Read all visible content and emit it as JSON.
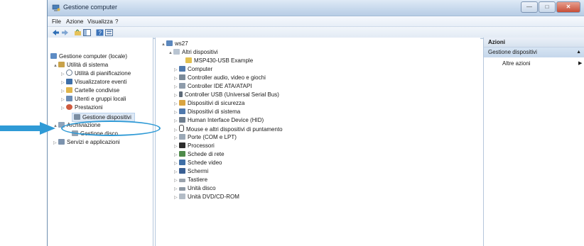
{
  "window": {
    "title": "Gestione computer"
  },
  "menu": [
    "File",
    "Azione",
    "Visualizza",
    "?"
  ],
  "tree": [
    {
      "label": "Gestione computer (locale)",
      "level": 0,
      "expander": ""
    },
    {
      "label": "Utilità di sistema",
      "level": 1,
      "expander": "▲"
    },
    {
      "label": "Utilità di pianificazione",
      "level": 2,
      "expander": "▷"
    },
    {
      "label": "Visualizzatore eventi",
      "level": 2,
      "expander": "▷"
    },
    {
      "label": "Cartelle condivise",
      "level": 2,
      "expander": "▷"
    },
    {
      "label": "Utenti e gruppi locali",
      "level": 2,
      "expander": "▷"
    },
    {
      "label": "Prestazioni",
      "level": 2,
      "expander": "▷"
    },
    {
      "label": "Gestione dispositivi",
      "level": 2,
      "expander": "",
      "selected": true
    },
    {
      "label": "Archiviazione",
      "level": 1,
      "expander": "▲"
    },
    {
      "label": "Gestione disco",
      "level": 2,
      "expander": ""
    },
    {
      "label": "Servizi e applicazioni",
      "level": 1,
      "expander": "▷"
    }
  ],
  "devices": [
    {
      "label": "ws27",
      "level": 0,
      "expander": "▲"
    },
    {
      "label": "Altri dispositivi",
      "level": 1,
      "expander": "▲"
    },
    {
      "label": "MSP430-USB Example",
      "level": 2,
      "expander": ""
    },
    {
      "label": "Computer",
      "level": 1,
      "expander": "▷"
    },
    {
      "label": "Controller audio, video e giochi",
      "level": 1,
      "expander": "▷"
    },
    {
      "label": "Controller IDE ATA/ATAPI",
      "level": 1,
      "expander": "▷"
    },
    {
      "label": "Controller USB (Universal Serial Bus)",
      "level": 1,
      "expander": "▷"
    },
    {
      "label": "Dispositivi di sicurezza",
      "level": 1,
      "expander": "▷"
    },
    {
      "label": "Dispositivi di sistema",
      "level": 1,
      "expander": "▷"
    },
    {
      "label": "Human Interface Device (HID)",
      "level": 1,
      "expander": "▷"
    },
    {
      "label": "Mouse e altri dispositivi di puntamento",
      "level": 1,
      "expander": "▷"
    },
    {
      "label": "Porte (COM e LPT)",
      "level": 1,
      "expander": "▷"
    },
    {
      "label": "Processori",
      "level": 1,
      "expander": "▷"
    },
    {
      "label": "Schede di rete",
      "level": 1,
      "expander": "▷"
    },
    {
      "label": "Schede video",
      "level": 1,
      "expander": "▷"
    },
    {
      "label": "Schermi",
      "level": 1,
      "expander": "▷"
    },
    {
      "label": "Tastiere",
      "level": 1,
      "expander": "▷"
    },
    {
      "label": "Unità disco",
      "level": 1,
      "expander": "▷"
    },
    {
      "label": "Unità DVD/CD-ROM",
      "level": 1,
      "expander": "▷"
    }
  ],
  "actions": {
    "header": "Azioni",
    "section": "Gestione dispositivi",
    "section_arrow": "▲",
    "more": "Altre azioni",
    "more_arrow": "▶"
  },
  "colors": {
    "annotation": "#2f9ad6"
  }
}
